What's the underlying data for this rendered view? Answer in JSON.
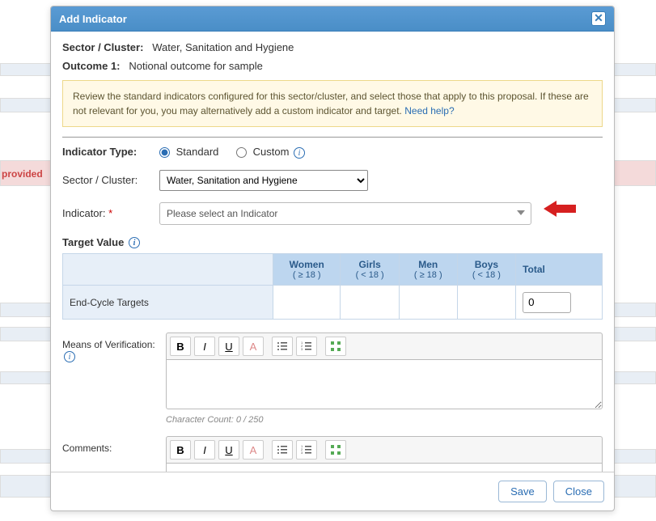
{
  "bg": {
    "provided": "provided"
  },
  "modal": {
    "title": "Add Indicator",
    "sector_label": "Sector / Cluster:",
    "sector_value": "Water, Sanitation and Hygiene",
    "outcome_label": "Outcome 1:",
    "outcome_value": "Notional outcome for sample",
    "help_text": "Review the standard indicators configured for this sector/cluster, and select those that apply to this proposal. If these are not relevant for you, you may alternatively add a custom indicator and target. ",
    "help_link": "Need help?",
    "indicator_type_label": "Indicator Type:",
    "radio_standard": "Standard",
    "radio_custom": "Custom",
    "sub_sector_label": "Sector / Cluster:",
    "sub_sector_value": "Water, Sanitation and Hygiene",
    "indicator_label": "Indicator:",
    "indicator_placeholder": "Please select an Indicator",
    "target_value_label": "Target Value",
    "table": {
      "row_label": "End-Cycle Targets",
      "cols": [
        {
          "h": "Women",
          "s": "( ≥ 18 )"
        },
        {
          "h": "Girls",
          "s": "( < 18 )"
        },
        {
          "h": "Men",
          "s": "( ≥ 18 )"
        },
        {
          "h": "Boys",
          "s": "( < 18 )"
        },
        {
          "h": "Total",
          "s": ""
        }
      ],
      "total_value": "0"
    },
    "mov_label": "Means of Verification:",
    "char_count": "Character Count: 0 / 250",
    "comments_label": "Comments:",
    "save": "Save",
    "close": "Close"
  }
}
